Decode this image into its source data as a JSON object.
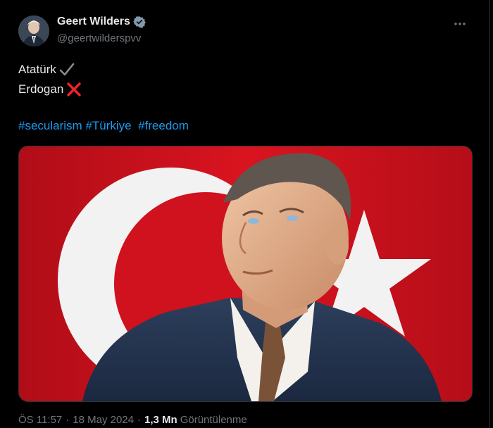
{
  "author": {
    "name": "Geert Wilders",
    "handle": "@geertwilderspvv"
  },
  "tweet": {
    "line1": "Atatürk",
    "line1_icon": "check-mark-icon",
    "line2": "Erdogan",
    "line2_icon": "cross-mark-icon",
    "hashtags": [
      "#secularism",
      "#Türkiye",
      "#freedom"
    ]
  },
  "meta": {
    "time": "ÖS 11:57",
    "separator": "·",
    "date": "18 May 2024",
    "views_count": "1,3 Mn",
    "views_label": "Görüntülenme"
  },
  "colors": {
    "background": "#000000",
    "text": "#e7e9ea",
    "secondary": "#71767b",
    "link": "#1d9bf0",
    "verified": "#829aab",
    "cross": "#f4212e",
    "flag_red": "#c8101c"
  }
}
